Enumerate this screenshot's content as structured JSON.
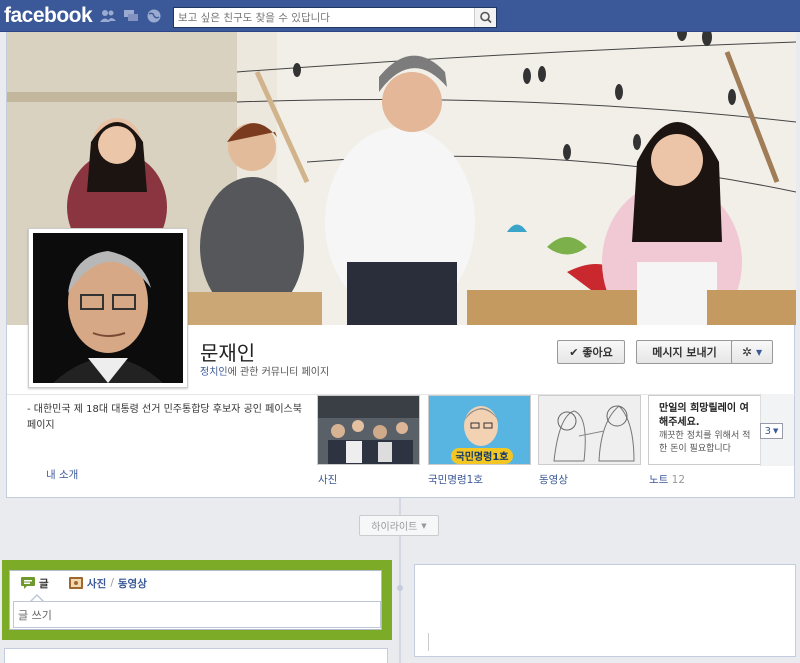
{
  "topbar": {
    "logo": "facebook",
    "search_placeholder": "보고 싶은 친구도 찾을 수 있답니다"
  },
  "profile": {
    "name": "문재인",
    "subtitle_link": "정치인",
    "subtitle_rest": "에 관한 커뮤니티 페이지",
    "like_label": "좋아요",
    "message_label": "메시지 보내기"
  },
  "about": {
    "text": "- 대한민국 제 18대 대통령 선거 민주통합당 후보자 공인 페이스북 페이지",
    "link": "내 소개"
  },
  "tiles": [
    {
      "label": "사진",
      "count": ""
    },
    {
      "label": "국민명령1호",
      "count": "",
      "image_text": "국민명령1호"
    },
    {
      "label": "동영상",
      "count": ""
    },
    {
      "label": "노트",
      "count": "12",
      "note_title": "만일의 희망릴레이 여해주세요.",
      "note_body": "깨끗한 정치를 위해서 적한 돈이 필요합니다"
    }
  ],
  "more": "3",
  "highlights": "하이라이트",
  "composer": {
    "tab_status": "글",
    "tab_photo": "사진",
    "tab_video": "동영상",
    "input_placeholder": "글 쓰기"
  },
  "colors": {
    "topbar": "#3b5998",
    "composer_border": "#7cab28",
    "link": "#3b5998"
  }
}
